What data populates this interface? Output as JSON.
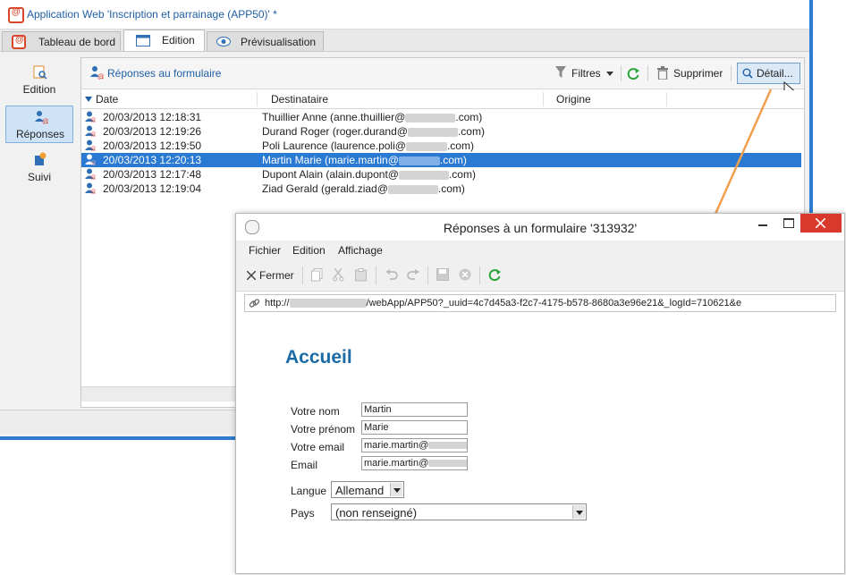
{
  "main_window": {
    "title": "Application Web 'Inscription et parrainage (APP50)' *",
    "tabs": [
      {
        "label": "Tableau de bord"
      },
      {
        "label": "Edition"
      },
      {
        "label": "Prévisualisation"
      }
    ],
    "left_nav": [
      {
        "label": "Edition"
      },
      {
        "label": "Réponses"
      },
      {
        "label": "Suivi"
      }
    ],
    "section_title": "Réponses au formulaire",
    "toolbar": {
      "filters_label": "Filtres",
      "delete_label": "Supprimer",
      "detail_label": "Détail..."
    },
    "columns": [
      "Date",
      "Destinataire",
      "Origine"
    ],
    "rows": [
      {
        "date": "20/03/2013 12:18:31",
        "recipient_prefix": "Thuillier Anne (anne.thuillier@",
        "recipient_suffix": ".com)"
      },
      {
        "date": "20/03/2013 12:19:26",
        "recipient_prefix": "Durand Roger (roger.durand@",
        "recipient_suffix": ".com)"
      },
      {
        "date": "20/03/2013 12:19:50",
        "recipient_prefix": "Poli Laurence (laurence.poli@",
        "recipient_suffix": ".com)"
      },
      {
        "date": "20/03/2013 12:20:13",
        "recipient_prefix": "Martin Marie (marie.martin@",
        "recipient_suffix": ".com)"
      },
      {
        "date": "20/03/2013 12:17:48",
        "recipient_prefix": "Dupont Alain (alain.dupont@",
        "recipient_suffix": ".com)"
      },
      {
        "date": "20/03/2013 12:19:04",
        "recipient_prefix": "Ziad Gerald (gerald.ziad@",
        "recipient_suffix": ".com)"
      }
    ],
    "selected_row_index": 3
  },
  "popup": {
    "title": "Réponses à un formulaire '313932'",
    "menu": [
      "Fichier",
      "Edition",
      "Affichage"
    ],
    "close_label": "Fermer",
    "url_prefix": "http://",
    "url_suffix": "/webApp/APP50?_uuid=4c7d45a3-f2c7-4175-b578-8680a3e96e21&_logId=710621&e",
    "heading": "Accueil",
    "form": {
      "nom_label": "Votre nom",
      "nom_value": "Martin",
      "prenom_label": "Votre prénom",
      "prenom_value": "Marie",
      "email_label": "Votre email",
      "email_value": "marie.martin@",
      "email_value_suffix": ".c",
      "email2_label": "Email",
      "email2_value": "marie.martin@",
      "email2_value_suffix": ".c",
      "langue_label": "Langue",
      "langue_value": "Allemand",
      "pays_label": "Pays",
      "pays_value": "(non renseigné)"
    }
  },
  "colors": {
    "accent_blue": "#1f5fa6",
    "selection_blue": "#2a7ad3",
    "heading_blue": "#1a6aa6",
    "arrow_orange": "#f0a050",
    "close_red": "#d9382c",
    "brand_red": "#d9472b",
    "refresh_green": "#2aa33a"
  },
  "icons": [
    "app-icon",
    "dashboard-icon",
    "edition-icon",
    "preview-eye-icon",
    "responses-icon",
    "tracking-icon",
    "filter-icon",
    "refresh-icon",
    "trash-icon",
    "search-icon",
    "close-x-icon",
    "copy-icon",
    "cut-icon",
    "paste-icon",
    "undo-icon",
    "redo-icon",
    "save-icon",
    "cancel-icon",
    "link-icon",
    "minimize-icon",
    "maximize-icon",
    "window-close-icon",
    "mouse-cursor-icon"
  ]
}
